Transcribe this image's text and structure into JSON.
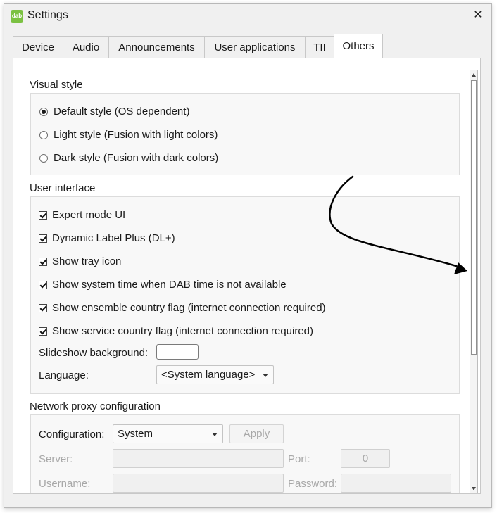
{
  "window": {
    "app_icon_text": "dab",
    "title": "Settings",
    "close_glyph": "✕"
  },
  "tabs": [
    {
      "label": "Device",
      "active": false
    },
    {
      "label": "Audio",
      "active": false
    },
    {
      "label": "Announcements",
      "active": false
    },
    {
      "label": "User applications",
      "active": false
    },
    {
      "label": "TII",
      "active": false
    },
    {
      "label": "Others",
      "active": true
    }
  ],
  "visual_style": {
    "title": "Visual style",
    "options": [
      {
        "label": "Default style (OS dependent)",
        "checked": true
      },
      {
        "label": "Light style (Fusion with light colors)",
        "checked": false
      },
      {
        "label": "Dark style (Fusion with dark colors)",
        "checked": false
      }
    ]
  },
  "user_interface": {
    "title": "User interface",
    "checkboxes": [
      {
        "label": "Expert mode UI",
        "checked": true
      },
      {
        "label": "Dynamic Label Plus (DL+)",
        "checked": true
      },
      {
        "label": "Show tray icon",
        "checked": true
      },
      {
        "label": "Show system time when DAB time is not available",
        "checked": true
      },
      {
        "label": "Show ensemble country flag (internet connection required)",
        "checked": true
      },
      {
        "label": "Show service country flag (internet connection required)",
        "checked": true
      }
    ],
    "slideshow_label": "Slideshow background:",
    "slideshow_color": "#ffffff",
    "language_label": "Language:",
    "language_value": "<System language>"
  },
  "network_proxy": {
    "title": "Network proxy configuration",
    "configuration_label": "Configuration:",
    "configuration_value": "System",
    "apply_label": "Apply",
    "server_label": "Server:",
    "server_value": "",
    "port_label": "Port:",
    "port_value": "0",
    "username_label": "Username:",
    "username_value": "",
    "password_label": "Password:",
    "password_value": ""
  },
  "colors": {
    "app_icon": "#7bc142",
    "annotation_arrow": "#000000"
  }
}
